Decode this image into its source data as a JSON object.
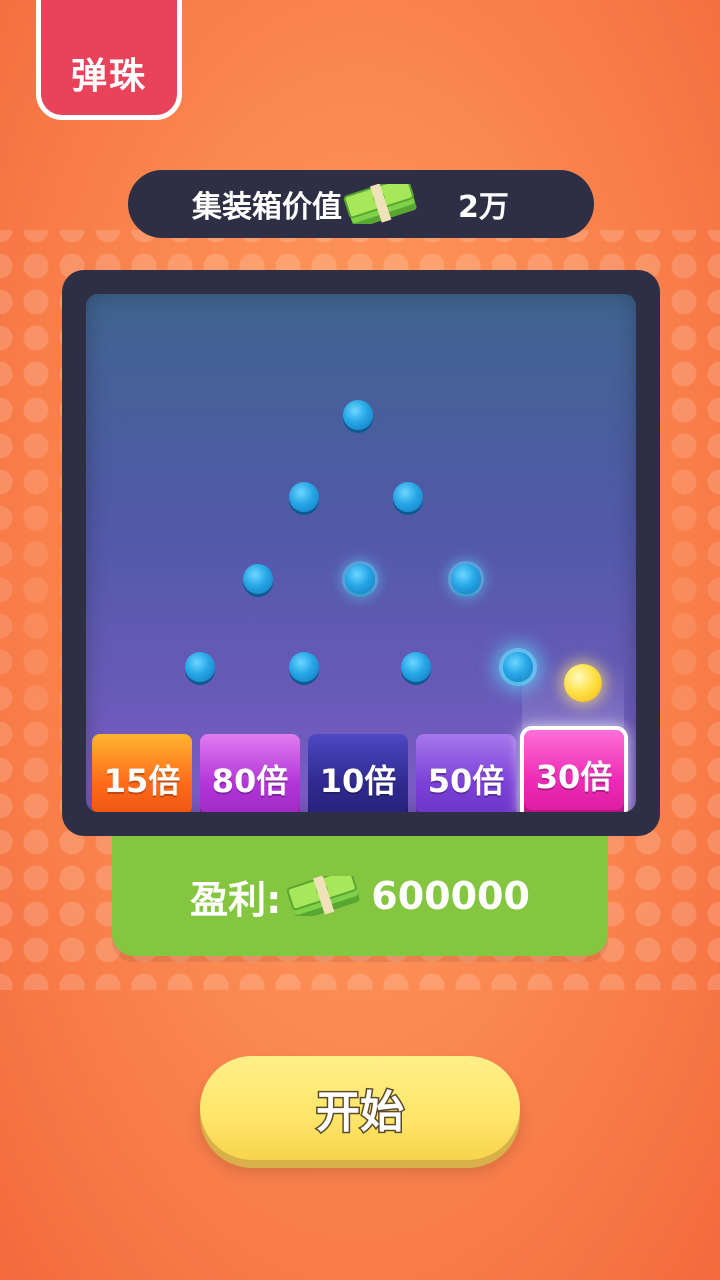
{
  "tag": {
    "label": "弹珠"
  },
  "container_value": {
    "label": "集装箱价值",
    "amount": "2万"
  },
  "slots": [
    {
      "label": "15倍"
    },
    {
      "label": "80倍"
    },
    {
      "label": "10倍"
    },
    {
      "label": "50倍"
    },
    {
      "label": "30倍",
      "selected": true
    }
  ],
  "profit": {
    "label": "盈利:",
    "amount": "600000"
  },
  "start_button": {
    "label": "开始"
  },
  "icons": {
    "money": "cash-stack-icon"
  },
  "colors": {
    "board": "#2e2f45",
    "profit_bg": "#84c63f",
    "start_bg": "#ffe56a",
    "tag_bg": "#e8435a"
  }
}
